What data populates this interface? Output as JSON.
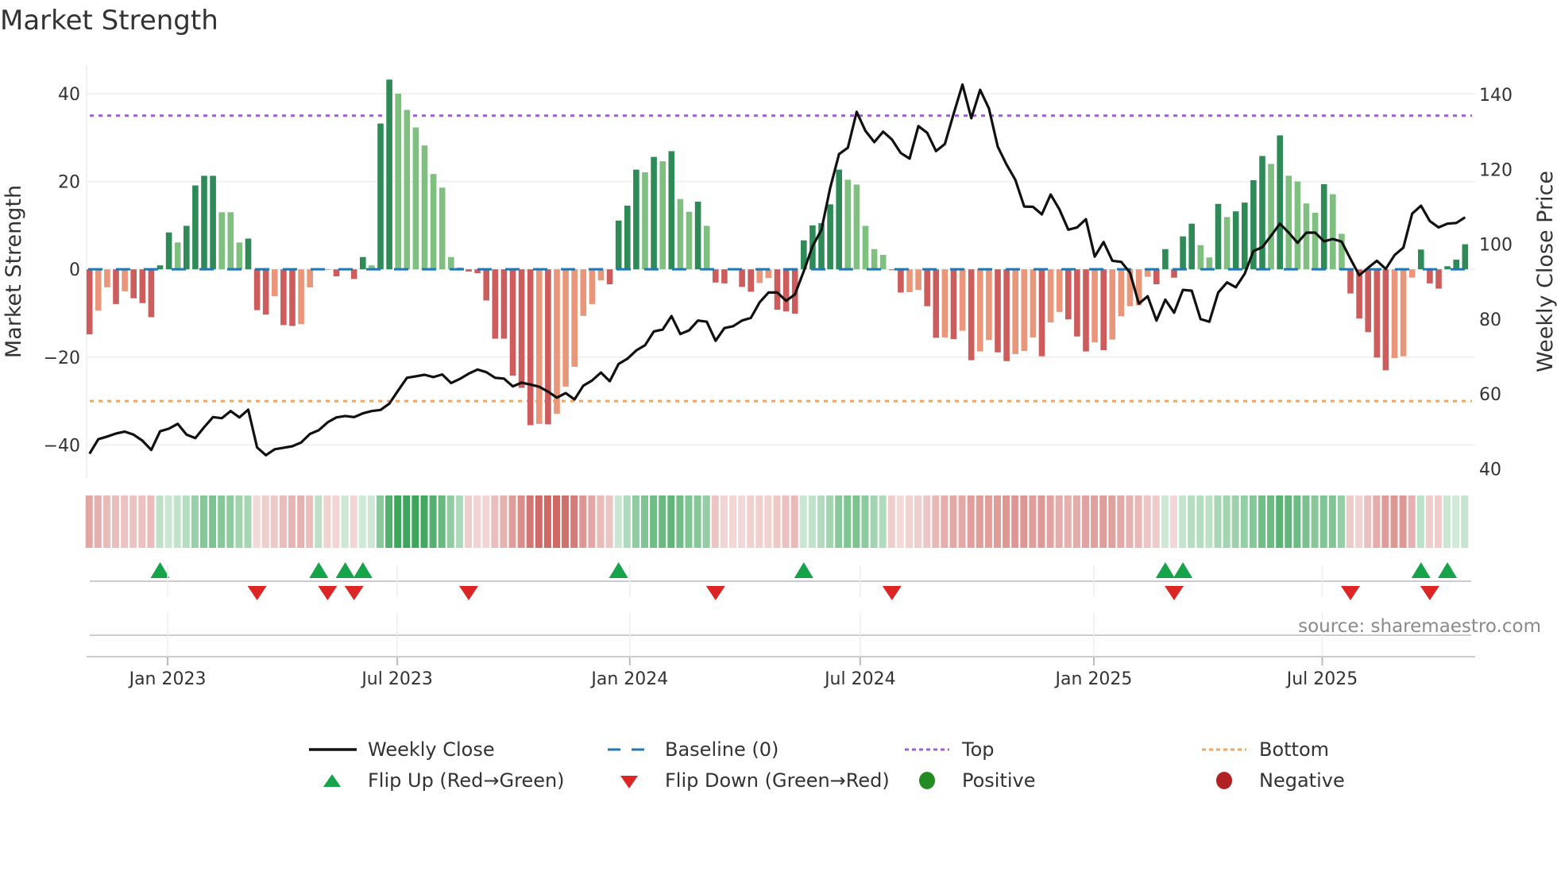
{
  "title": "Market Strength",
  "source": "source: sharemaestro.com",
  "colors": {
    "pos_strong": "#2e8b57",
    "pos_weak": "#7fbf7f",
    "neg_strong": "#cd5c5c",
    "neg_weak": "#e9967a",
    "baseline": "#1f77b4",
    "top": "#9b63d9",
    "bottom": "#f4a460",
    "close": "#111111",
    "flip_up": "#16a34a",
    "flip_down": "#dc2626",
    "positive": "#228b22",
    "negative": "#b22222"
  },
  "chart_data": {
    "type": "bar",
    "title": "Market Strength",
    "ylabel": "Market Strength",
    "y2label": "Weekly Close Price",
    "ylim": [
      -47.7,
      46.5
    ],
    "y2lim": [
      37.3,
      147.9
    ],
    "yticks": [
      40,
      20,
      0,
      -20,
      -40
    ],
    "y2ticks": [
      140,
      120,
      100,
      80,
      60,
      40
    ],
    "top_level": 35,
    "bottom_level": -30,
    "baseline": 0,
    "x_unit": "week index",
    "xticks": [
      {
        "label": "Jan 2023",
        "week": 8.86
      },
      {
        "label": "Jul 2023",
        "week": 34.9
      },
      {
        "label": "Jan 2024",
        "week": 61.27
      },
      {
        "label": "Jul 2024",
        "week": 87.4
      },
      {
        "label": "Jan 2025",
        "week": 113.9
      },
      {
        "label": "Jul 2025",
        "week": 139.8
      }
    ],
    "strength": [
      -14.8,
      -9.4,
      -4.1,
      -7.9,
      -5,
      -6.6,
      -7.7,
      -10.9,
      0.9,
      8.4,
      6.1,
      9.9,
      19.1,
      21.3,
      21.3,
      13,
      13,
      6.1,
      7,
      -9.3,
      -10.3,
      -6.1,
      -12.7,
      -12.9,
      -12.5,
      -4.1,
      0.1,
      -0.1,
      -1.6,
      0.2,
      -2.2,
      2.8,
      0.9,
      33.2,
      43.2,
      40,
      36.3,
      32.3,
      28.2,
      21.7,
      18.6,
      2.8,
      0.4,
      -0.5,
      -0.9,
      -7.1,
      -15.8,
      -15.8,
      -24.2,
      -27,
      -35.5,
      -35.2,
      -35.3,
      -32.9,
      -26.7,
      -22.2,
      -10.6,
      -7.9,
      -2.5,
      -3.4,
      11.1,
      14.5,
      22.7,
      22.1,
      25.6,
      24.6,
      26.9,
      16,
      13.1,
      15.4,
      9.9,
      -3,
      -3.2,
      -0.1,
      -4,
      -5.1,
      -3.1,
      -2,
      -9.2,
      -9.6,
      -10.1,
      6.6,
      10,
      10.5,
      14.8,
      22.7,
      20.4,
      19.3,
      9.9,
      4.6,
      3.3,
      -0.2,
      -5.3,
      -5.2,
      -4.7,
      -8.4,
      -15.6,
      -15.5,
      -15.9,
      -14,
      -20.7,
      -18.7,
      -16.1,
      -18.9,
      -20.9,
      -19.3,
      -18.6,
      -15.5,
      -19.8,
      -12.1,
      -9.7,
      -11.4,
      -15.3,
      -18.7,
      -16.6,
      -18.4,
      -16,
      -10.7,
      -8.4,
      -8.2,
      -1.7,
      -3.4,
      4.6,
      -1.9,
      7.5,
      10.4,
      5.5,
      2.7,
      14.9,
      11.9,
      13.2,
      15.2,
      20.3,
      25.8,
      24,
      30.5,
      21.3,
      20,
      15,
      12.9,
      19.4,
      17.1,
      8.1,
      -5.5,
      -11.2,
      -14.3,
      -20.1,
      -23,
      -20.2,
      -19.8,
      -1.9,
      4.5,
      -3.2,
      -4.4,
      0.7,
      2.2,
      5.7
    ],
    "weekly_close": [
      44,
      47.9,
      48.6,
      49.4,
      49.9,
      49.1,
      47.5,
      45,
      50,
      50.7,
      52,
      49.1,
      48.2,
      51.1,
      53.8,
      53.5,
      55.4,
      53.7,
      55.8,
      45.7,
      43.6,
      45.2,
      45.6,
      46,
      47,
      49.3,
      50.3,
      52.4,
      53.7,
      54.1,
      53.8,
      54.8,
      55.4,
      55.7,
      57.4,
      60.9,
      64.3,
      64.7,
      65.1,
      64.5,
      65.2,
      62.9,
      64,
      65.4,
      66.5,
      65.8,
      64.3,
      64.1,
      62,
      63,
      62.5,
      61.9,
      60.6,
      59,
      60.2,
      58.5,
      62.2,
      63.6,
      65.7,
      63.4,
      68,
      69.4,
      71.6,
      73,
      76.7,
      77.2,
      80.8,
      76,
      77,
      79.6,
      79.3,
      74.2,
      77.6,
      78.1,
      79.6,
      80.3,
      84.5,
      87.1,
      87.1,
      84.9,
      86.6,
      92.8,
      99.5,
      103.8,
      115.1,
      124.1,
      125.8,
      135.4,
      130.3,
      127.3,
      130.1,
      128,
      124.4,
      122.9,
      131.6,
      129.8,
      124.9,
      126.8,
      134.9,
      142.7,
      133.7,
      141.3,
      136.3,
      126.1,
      121.3,
      117.2,
      110.1,
      110,
      108,
      113.3,
      109.3,
      103.9,
      104.5,
      106.7,
      96.7,
      100.6,
      95.6,
      95.3,
      92.4,
      84.1,
      86.1,
      79.6,
      85.2,
      81.7,
      87.8,
      87.6,
      80,
      79.3,
      87.1,
      89.8,
      88.5,
      92.1,
      98.2,
      99.2,
      102.3,
      105.5,
      103.1,
      100.4,
      103.1,
      103.1,
      100.8,
      101.4,
      100.7,
      96.1,
      91.7,
      93.7,
      95.6,
      93.4,
      97.1,
      99.1,
      108.2,
      110.3,
      106.2,
      104.5,
      105.5,
      105.7,
      107.2
    ],
    "legend": {
      "placement": "bottom-center",
      "items": [
        {
          "label": "Weekly Close",
          "symbol": "line"
        },
        {
          "label": "Baseline (0)",
          "symbol": "dashed"
        },
        {
          "label": "Top",
          "symbol": "dotted-top"
        },
        {
          "label": "Bottom",
          "symbol": "dotted-bottom"
        },
        {
          "label": "Flip Up (Red→Green)",
          "symbol": "triangle-up"
        },
        {
          "label": "Flip Down (Green→Red)",
          "symbol": "triangle-down"
        },
        {
          "label": "Positive",
          "symbol": "dot-positive"
        },
        {
          "label": "Negative",
          "symbol": "dot-negative"
        }
      ]
    }
  }
}
